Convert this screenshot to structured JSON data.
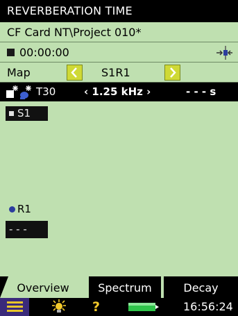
{
  "title": "REVERBERATION TIME",
  "path": "CF  Card NT\\Project 010*",
  "elapsed_time": "00:00:00",
  "map": {
    "label": "Map",
    "position": "S1R1"
  },
  "param_bar": {
    "parameter": "T30",
    "frequency": "‹ 1.25 kHz ›",
    "value": "- - -  s"
  },
  "source": {
    "label": "S1"
  },
  "receiver": {
    "label": "R1",
    "value": "- - -"
  },
  "tabs": [
    {
      "label": "Overview",
      "active": true
    },
    {
      "label": "Spectrum",
      "active": false
    },
    {
      "label": "Decay",
      "active": false
    }
  ],
  "status": {
    "help_glyph": "?",
    "clock": "16:56:24"
  },
  "colors": {
    "panel_green": "#bfe0b0",
    "button_yellow": "#cfd936",
    "receiver_blue": "#2c3d9e",
    "menu_purple": "#3a2a7a",
    "battery_green": "#2fc44a"
  }
}
